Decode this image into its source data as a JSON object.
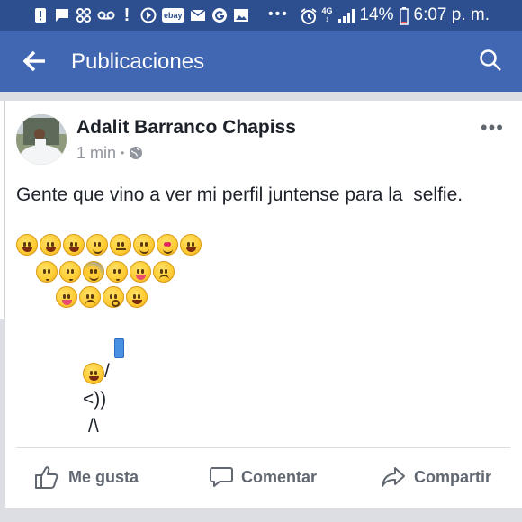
{
  "status_bar": {
    "icons_left": [
      "alert-icon",
      "message-icon",
      "app-icon",
      "voicemail-icon",
      "alert-icon",
      "arrow-circle-icon",
      "ebay-icon",
      "mail-icon",
      "g-icon",
      "gallery-icon"
    ],
    "ebay_label": "ebay",
    "dots": "•••",
    "icons_right": [
      "alarm-icon",
      "data-icon",
      "signal-icon"
    ],
    "battery_percent": "14%",
    "time": "6:07 p. m."
  },
  "appbar": {
    "title": "Publicaciones",
    "back_icon": "arrow-left-icon",
    "search_icon": "search-icon"
  },
  "post": {
    "author": "Adalit Barranco Chapiss",
    "time": "1 min",
    "separator": "•",
    "privacy_icon": "globe-icon",
    "more": "•••",
    "text": "Gente que vino a ver mi perfil juntense para la  selfie.",
    "emoji_rows": [
      [
        "grin",
        "smile",
        "smile",
        "blush",
        "neutral",
        "wink",
        "heart-eyes",
        "grimace"
      ],
      [
        "kiss",
        "kiss-closed",
        "fear",
        "kiss-smile",
        "tongue-wink",
        "unamused"
      ],
      [
        "tongue",
        "angry",
        "flushed",
        "joy"
      ]
    ],
    "ascii_art": {
      "arm": "/",
      "body": "<))",
      "legs": "/\\"
    },
    "selfie_emoji": "laughing",
    "phone_icon": "mobile-phone-icon"
  },
  "actions": {
    "like": "Me gusta",
    "comment": "Comentar",
    "share": "Compartir"
  },
  "colors": {
    "status_bar": "#2d4f8f",
    "app_bar": "#4267b2",
    "text": "#1d2129",
    "muted": "#90949c",
    "action": "#606770"
  }
}
